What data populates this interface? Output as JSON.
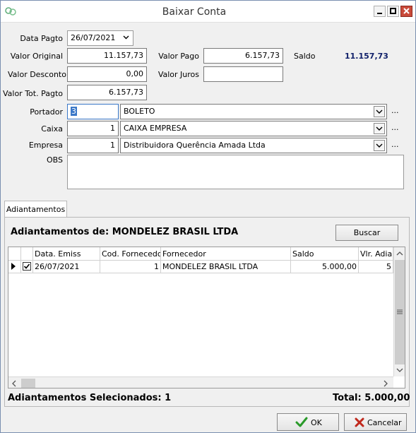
{
  "window": {
    "title": "Baixar Conta"
  },
  "form": {
    "data_pagto": {
      "label": "Data Pagto",
      "value": "26/07/2021"
    },
    "valor_original": {
      "label": "Valor Original",
      "value": "11.157,73"
    },
    "valor_pago": {
      "label": "Valor Pago",
      "value": "6.157,73"
    },
    "saldo": {
      "label": "Saldo",
      "value": "11.157,73"
    },
    "valor_desconto": {
      "label": "Valor Desconto",
      "value": "0,00"
    },
    "valor_juros": {
      "label": "Valor Juros",
      "value": ""
    },
    "valor_tot_pagto": {
      "label": "Valor Tot. Pagto",
      "value": "6.157,73"
    },
    "portador": {
      "label": "Portador",
      "code": "3",
      "name": "BOLETO"
    },
    "caixa": {
      "label": "Caixa",
      "code": "1",
      "name": "CAIXA EMPRESA"
    },
    "empresa": {
      "label": "Empresa",
      "code": "1",
      "name": "Distribuidora Querência Amada Ltda"
    },
    "obs": {
      "label": "OBS",
      "value": ""
    },
    "ellipsis": "..."
  },
  "tabs": {
    "adiantamentos": "Adiantamentos"
  },
  "adiantamentos": {
    "title": "Adiantamentos de: MONDELEZ BRASIL LTDA",
    "buscar_label": "Buscar",
    "columns": [
      "Data. Emiss",
      "Cod. Fornecedor",
      "Fornecedor",
      "Saldo",
      "Vlr. Adian"
    ],
    "rows": [
      {
        "checked": true,
        "data_emiss": "26/07/2021",
        "cod_fornecedor": "1",
        "fornecedor": "MONDELEZ BRASIL LTDA",
        "saldo": "5.000,00",
        "vlr_adian": "5"
      }
    ],
    "selecionados": "Adiantamentos Selecionados: 1",
    "total": "Total: 5.000,00"
  },
  "buttons": {
    "ok": "OK",
    "cancelar": "Cancelar"
  },
  "colors": {
    "saldo": "#10206a",
    "ok_icon": "#2a9a2a",
    "cancel_icon": "#c0281c",
    "close_button": "#c94a3a"
  }
}
